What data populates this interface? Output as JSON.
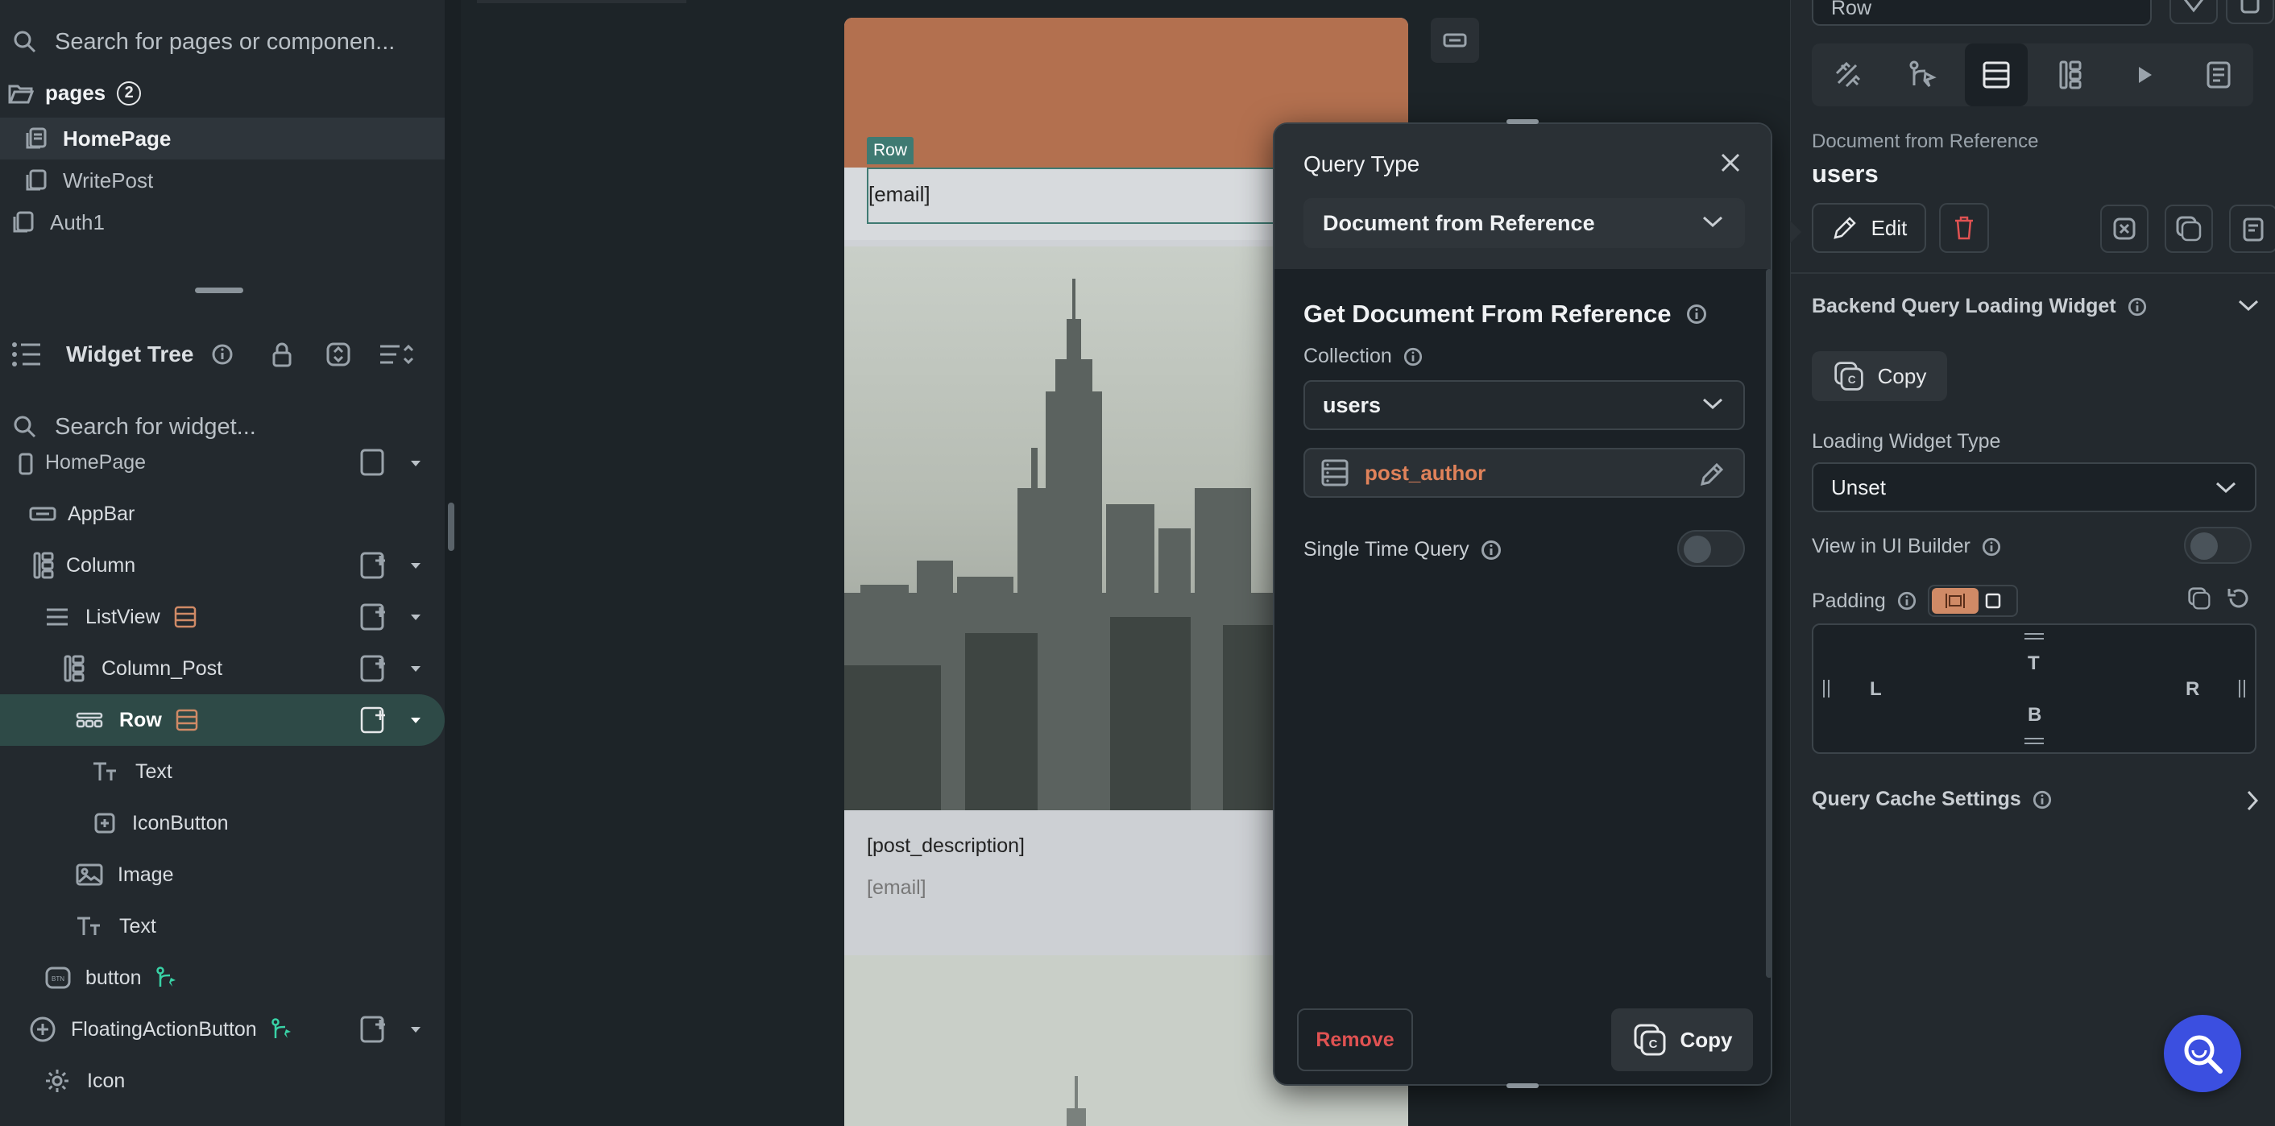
{
  "left_panel": {
    "search_pages_placeholder": "Search for pages or componen...",
    "pages_label": "pages",
    "pages_count": "2",
    "pages": [
      {
        "label": "HomePage",
        "active": true
      },
      {
        "label": "WritePost",
        "active": false
      },
      {
        "label": "Auth1",
        "active": false
      }
    ],
    "widget_tree_title": "Widget Tree",
    "search_widget_placeholder": "Search for widget...",
    "tree": [
      {
        "label": "HomePage"
      },
      {
        "label": "AppBar"
      },
      {
        "label": "Column"
      },
      {
        "label": "ListView"
      },
      {
        "label": "Column_Post"
      },
      {
        "label": "Row"
      },
      {
        "label": "Text"
      },
      {
        "label": "IconButton"
      },
      {
        "label": "Image"
      },
      {
        "label": "Text"
      },
      {
        "label": "button"
      },
      {
        "label": "FloatingActionButton"
      },
      {
        "label": "Icon"
      }
    ]
  },
  "canvas": {
    "row_tag": "Row",
    "email_text": "[email]",
    "post_description": "[post_description]",
    "email_secondary": "[email]"
  },
  "popup": {
    "title": "Query Type",
    "query_type_value": "Document from Reference",
    "section_title": "Get Document From Reference",
    "collection_label": "Collection",
    "collection_value": "users",
    "reference_field": "post_author",
    "single_time_label": "Single Time Query",
    "remove_label": "Remove",
    "copy_label": "Copy"
  },
  "right_panel": {
    "widget_name": "Row",
    "query_kind": "Document from Reference",
    "collection": "users",
    "edit_label": "Edit",
    "loading_section": "Backend Query Loading Widget",
    "copy_label": "Copy",
    "loading_type_label": "Loading Widget Type",
    "loading_type_value": "Unset",
    "view_in_builder_label": "View in UI Builder",
    "padding_label": "Padding",
    "padding_top": "T",
    "padding_bottom": "B",
    "padding_left": "L",
    "padding_right": "R",
    "cache_label": "Query Cache Settings"
  },
  "colors": {
    "accent_teal": "#2e4a47",
    "accent_orange": "#d08a66",
    "danger": "#e05252",
    "fab_blue": "#3b4fe0",
    "phone_header": "#b3704f"
  }
}
